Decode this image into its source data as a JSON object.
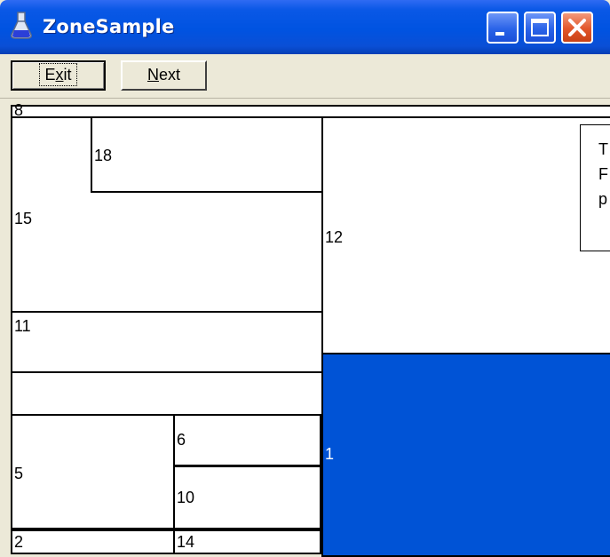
{
  "window": {
    "title": "ZoneSample",
    "icon": "flask-icon",
    "controls": [
      "minimize-icon",
      "maximize-icon",
      "close-icon"
    ]
  },
  "toolbar": {
    "exit_label": "Exit",
    "exit_mnemonic": "x",
    "next_label": "Next",
    "next_mnemonic": "N"
  },
  "zones": [
    {
      "id": "8",
      "label": "8"
    },
    {
      "id": "15",
      "label": "15"
    },
    {
      "id": "18",
      "label": "18"
    },
    {
      "id": "11",
      "label": "11"
    },
    {
      "id": "12",
      "label": "12"
    },
    {
      "id": "1",
      "label": "1",
      "selected": true
    },
    {
      "id": "5",
      "label": "5"
    },
    {
      "id": "6",
      "label": "6"
    },
    {
      "id": "10",
      "label": "10"
    },
    {
      "id": "2",
      "label": "2"
    },
    {
      "id": "14",
      "label": "14"
    }
  ],
  "popup": {
    "lines": [
      "T",
      "F",
      "p"
    ]
  },
  "colors": {
    "title_bar": "#0053e1",
    "selected_zone": "#0053d6",
    "window_background": "#ece9d8",
    "close_button": "#e2562a"
  }
}
